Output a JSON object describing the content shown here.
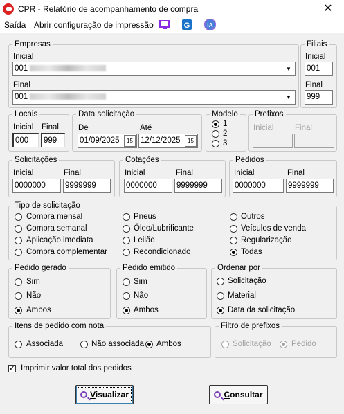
{
  "window": {
    "title": "CPR - Relatório de acompanhamento de compra",
    "close": "✕"
  },
  "menu": {
    "exit": "Saída",
    "print_config": "Abrir configuração de impressão",
    "ia": "IA"
  },
  "colors": {
    "accent_purple": "#7a3fb8",
    "brand_red": "#d22222",
    "monitor_icon": "#8a2be2",
    "g_icon": "#1a73c8"
  },
  "empresas": {
    "legend": "Empresas",
    "inicial_label": "Inicial",
    "inicial_value": "001",
    "final_label": "Final",
    "final_value": "001"
  },
  "filiais": {
    "legend": "Filiais",
    "inicial_label": "Inicial",
    "inicial_value": "001",
    "final_label": "Final",
    "final_value": "999"
  },
  "locais": {
    "legend": "Locais",
    "inicial_label": "Inicial",
    "inicial_value": "000",
    "final_label": "Final",
    "final_value": "999"
  },
  "data_solicitacao": {
    "legend": "Data solicitação",
    "de_label": "De",
    "de_value": "01/09/2025",
    "ate_label": "Até",
    "ate_value": "12/12/2025",
    "cal_icon": "15"
  },
  "modelo": {
    "legend": "Modelo",
    "options": [
      "1",
      "2",
      "3"
    ],
    "selected": "1"
  },
  "prefixos": {
    "legend": "Prefixos",
    "inicial_label": "Inicial",
    "final_label": "Final"
  },
  "solicitacoes": {
    "legend": "Solicitações",
    "inicial_label": "Inicial",
    "inicial_value": "0000000",
    "final_label": "Final",
    "final_value": "9999999"
  },
  "cotacoes": {
    "legend": "Cotações",
    "inicial_label": "Inicial",
    "inicial_value": "0000000",
    "final_label": "Final",
    "final_value": "9999999"
  },
  "pedidos": {
    "legend": "Pedidos",
    "inicial_label": "Inicial",
    "inicial_value": "0000000",
    "final_label": "Final",
    "final_value": "9999999"
  },
  "tipo_solicitacao": {
    "legend": "Tipo de solicitação",
    "options": [
      "Compra mensal",
      "Compra semanal",
      "Aplicação imediata",
      "Compra complementar",
      "Pneus",
      "Óleo/Lubrificante",
      "Leilão",
      "Recondicionado",
      "Outros",
      "Veículos de venda",
      "Regularização",
      "Todas"
    ],
    "selected": "Todas"
  },
  "pedido_gerado": {
    "legend": "Pedido gerado",
    "options": [
      "Sim",
      "Não",
      "Ambos"
    ],
    "selected": "Ambos"
  },
  "pedido_emitido": {
    "legend": "Pedido emitido",
    "options": [
      "Sim",
      "Não",
      "Ambos"
    ],
    "selected": "Ambos"
  },
  "ordenar_por": {
    "legend": "Ordenar por",
    "options": [
      "Solicitação",
      "Material",
      "Data da solicitação"
    ],
    "selected": "Data da solicitação"
  },
  "itens_nota": {
    "legend": "Itens de pedido com nota",
    "options": [
      "Associada",
      "Não associada",
      "Ambos"
    ],
    "selected": "Ambos"
  },
  "filtro_prefixos": {
    "legend": "Filtro de prefixos",
    "options": [
      "Solicitação",
      "Pedido"
    ],
    "selected": "Pedido"
  },
  "imprimir_total": {
    "label": "Imprimir valor total dos pedidos",
    "checked": true
  },
  "buttons": {
    "visualizar_first": "V",
    "visualizar_rest": "isualizar",
    "consultar_first": "C",
    "consultar_rest": "onsultar"
  }
}
